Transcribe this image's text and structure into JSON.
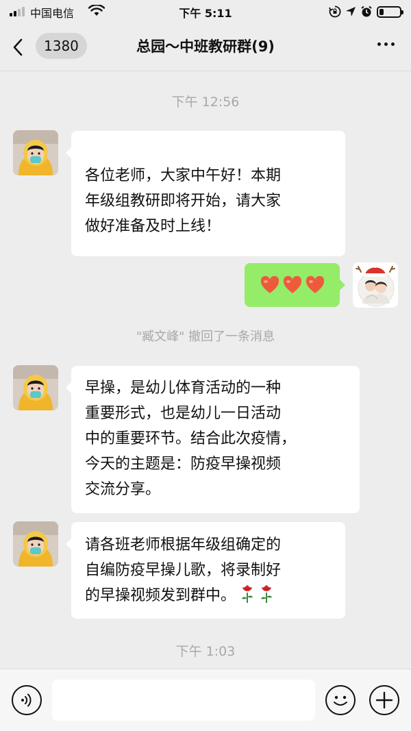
{
  "status_bar": {
    "carrier": "中国电信",
    "time": "下午 5:11",
    "battery_level": 0.15
  },
  "header": {
    "unread_count": "1380",
    "title": "总园～中班教研群(9)"
  },
  "messages": [
    {
      "type": "timestamp",
      "text": "下午 12:56"
    },
    {
      "type": "received",
      "avatar": "avatar-child-icon",
      "lines": [
        "各位老师，大家中午好！本期",
        "年级组教研即将开始，请大家",
        "做好准备及时上线！"
      ]
    },
    {
      "type": "sent",
      "avatar": "avatar-family-icon",
      "content": "❤️❤️❤️",
      "icons": [
        "heart-icon",
        "heart-icon",
        "heart-icon"
      ]
    },
    {
      "type": "system",
      "text": "\"臧文峰\" 撤回了一条消息"
    },
    {
      "type": "received",
      "avatar": "avatar-child-icon",
      "lines": [
        "早操，是幼儿体育活动的一种",
        "重要形式，也是幼儿一日活动",
        "中的重要环节。结合此次疫情，",
        "今天的主题是：防疫早操视频",
        "交流分享。"
      ]
    },
    {
      "type": "received",
      "avatar": "avatar-child-icon",
      "lines": [
        "请各班老师根据年级组确定的",
        "自编防疫早操儿歌，将录制好",
        "的早操视频发到群中。🌹🌹"
      ],
      "icons": [
        "rose-icon",
        "rose-icon"
      ]
    },
    {
      "type": "timestamp",
      "text": "下午 1:03"
    }
  ],
  "input_bar": {
    "value": "",
    "icons": [
      "voice-icon",
      "emoji-icon",
      "plus-icon"
    ]
  },
  "colors": {
    "background": "#ededed",
    "self_bubble": "#95ec69",
    "other_bubble": "#ffffff",
    "meta_text": "#a8a8a8"
  }
}
